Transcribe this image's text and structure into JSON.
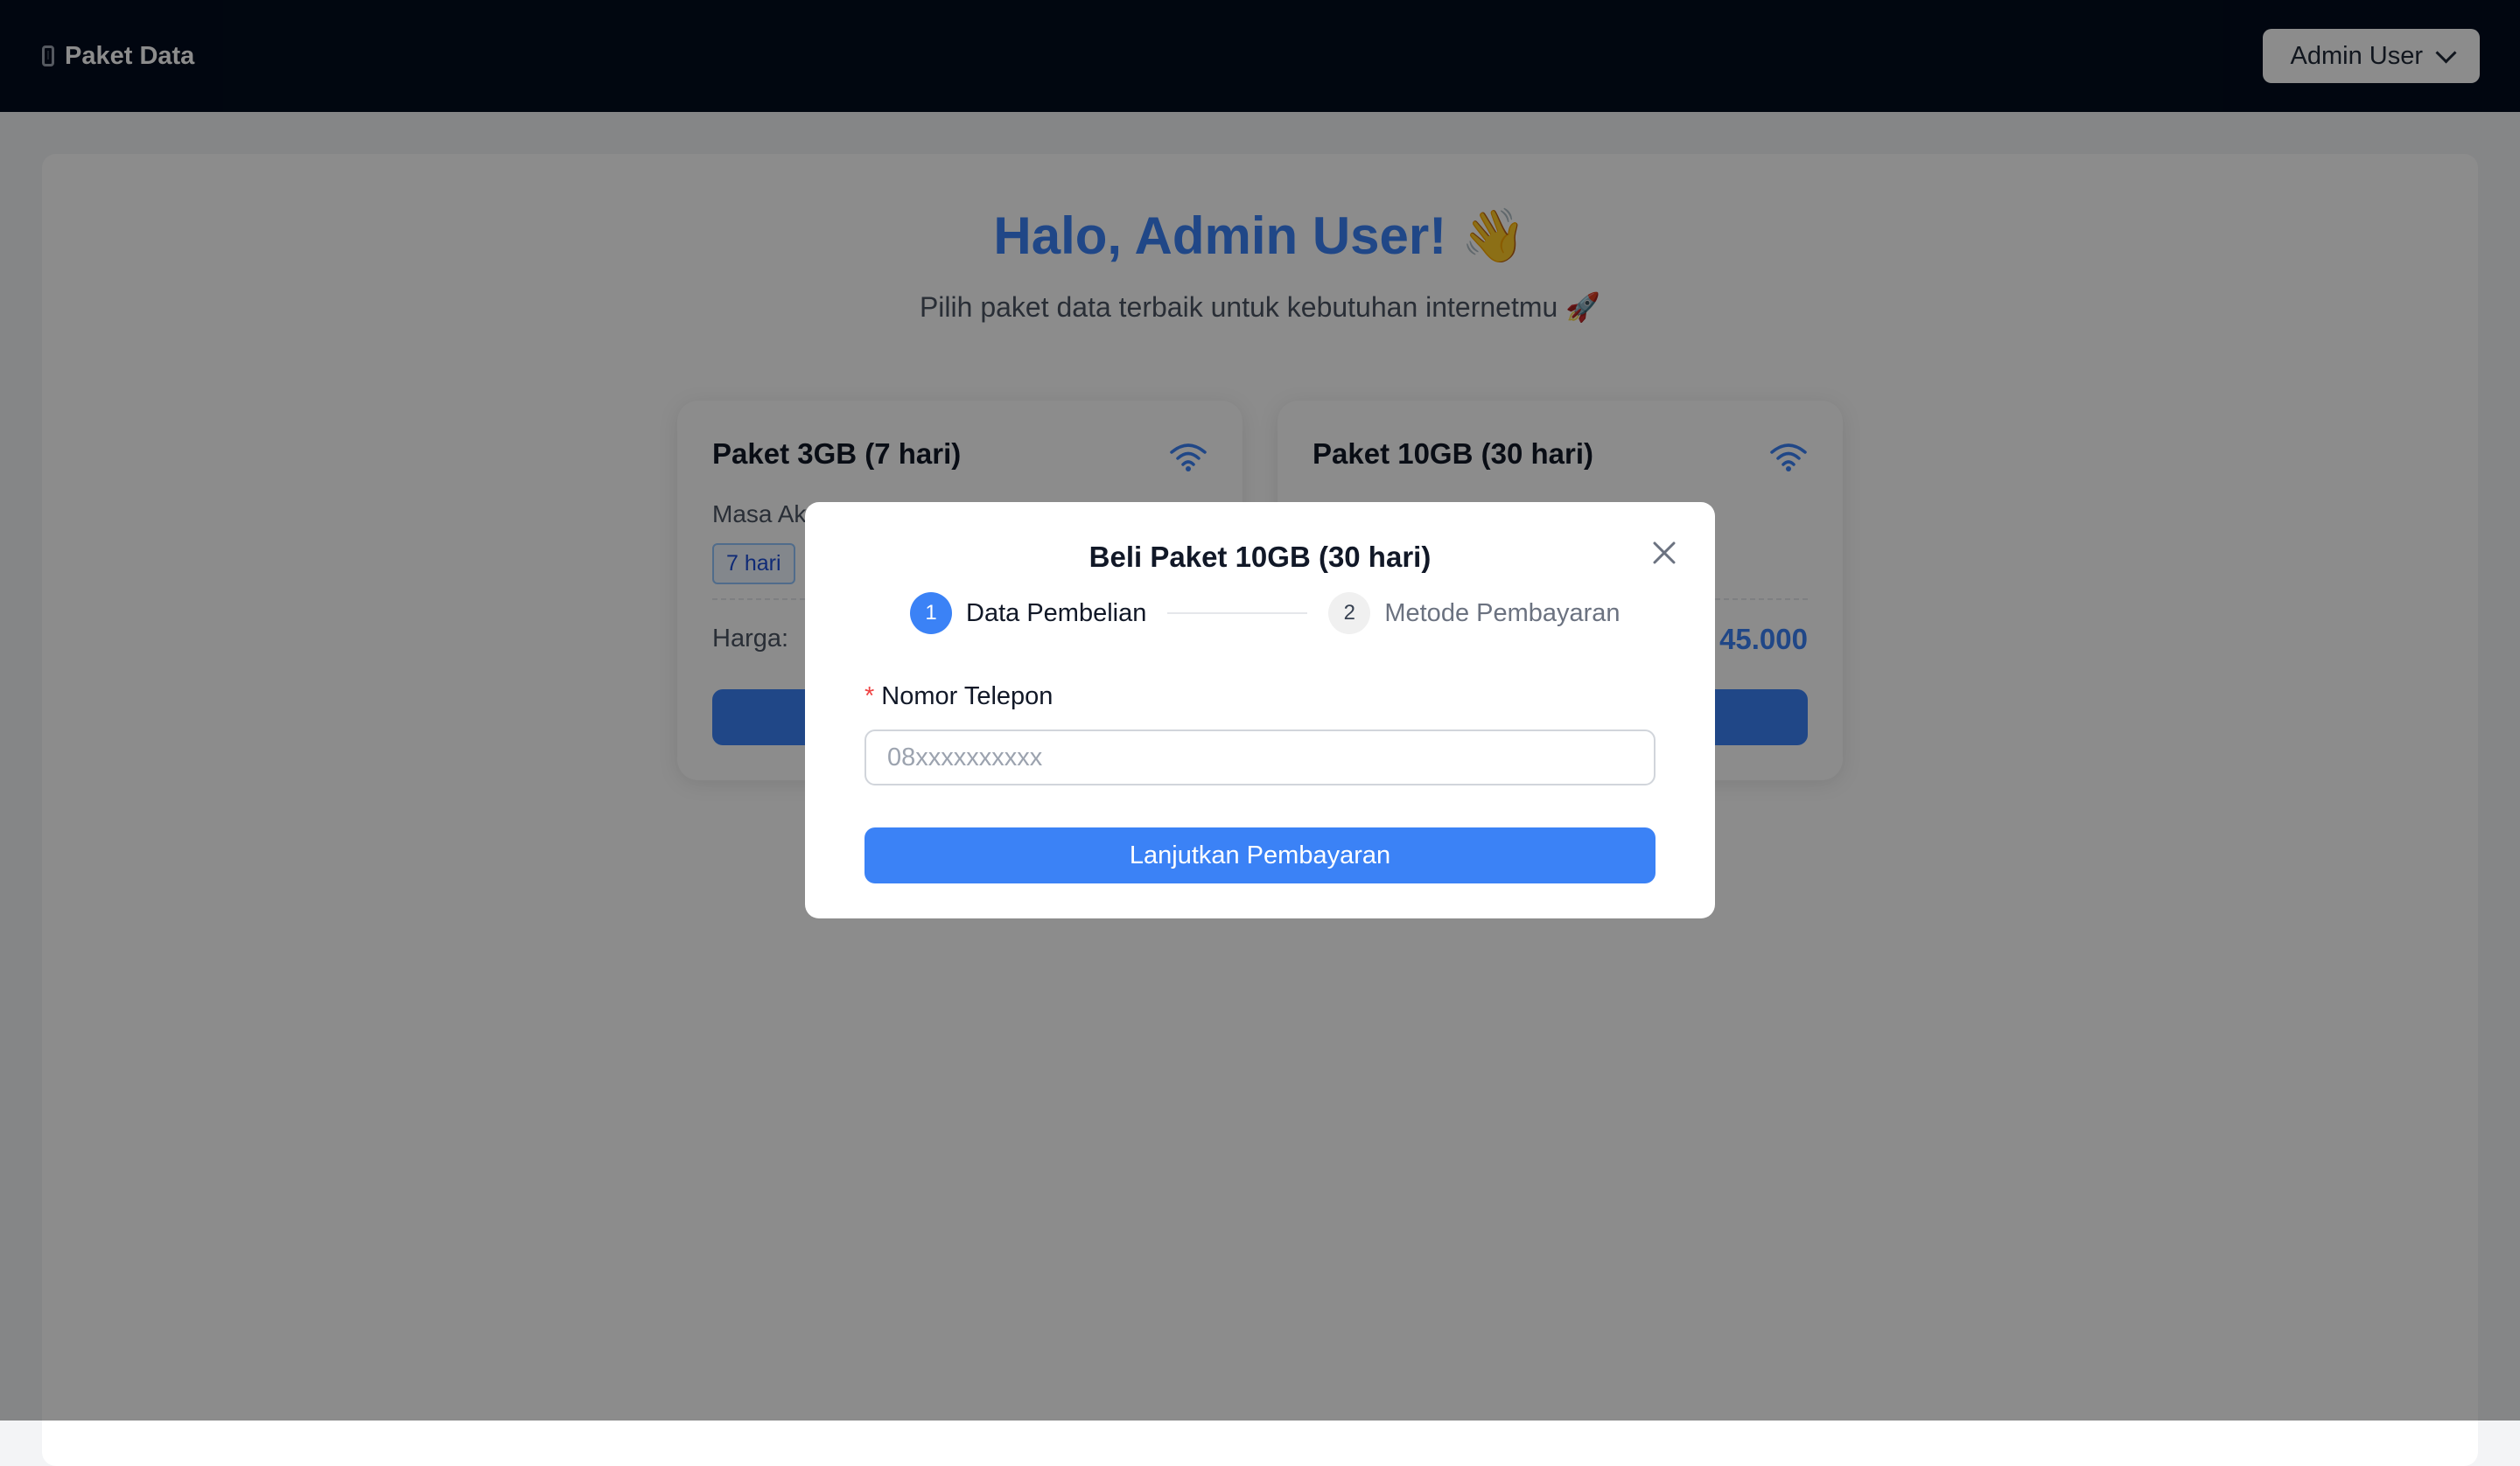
{
  "header": {
    "brand": "Paket Data",
    "user_menu_label": "Admin User"
  },
  "main": {
    "greeting": "Halo, Admin User!",
    "greeting_emoji": "👋",
    "subtitle": "Pilih paket data terbaik untuk kebutuhan internetmu 🚀"
  },
  "packages": [
    {
      "name": "Paket 3GB (7 hari)",
      "validity_label_visible": "Masa Ak",
      "validity_badge": "7 hari",
      "price_label": "Harga:"
    },
    {
      "name": "Paket 10GB (30 hari)",
      "price_visible": "45.000"
    }
  ],
  "modal": {
    "title": "Beli Paket 10GB (30 hari)",
    "steps": [
      {
        "number": "1",
        "label": "Data Pembelian",
        "state": "active"
      },
      {
        "number": "2",
        "label": "Metode Pembayaran",
        "state": "pending"
      }
    ],
    "required_marker": "*",
    "phone_label": "Nomor Telepon",
    "phone_value": "",
    "phone_placeholder": "08xxxxxxxxxx",
    "continue_label": "Lanjutkan Pembayaran"
  },
  "colors": {
    "header_bg": "#020c1e",
    "accent": "#3b82f6",
    "required": "#ef4444"
  },
  "icons": [
    "mobile-phone-icon",
    "chevron-down-icon",
    "wifi-icon",
    "close-icon"
  ]
}
